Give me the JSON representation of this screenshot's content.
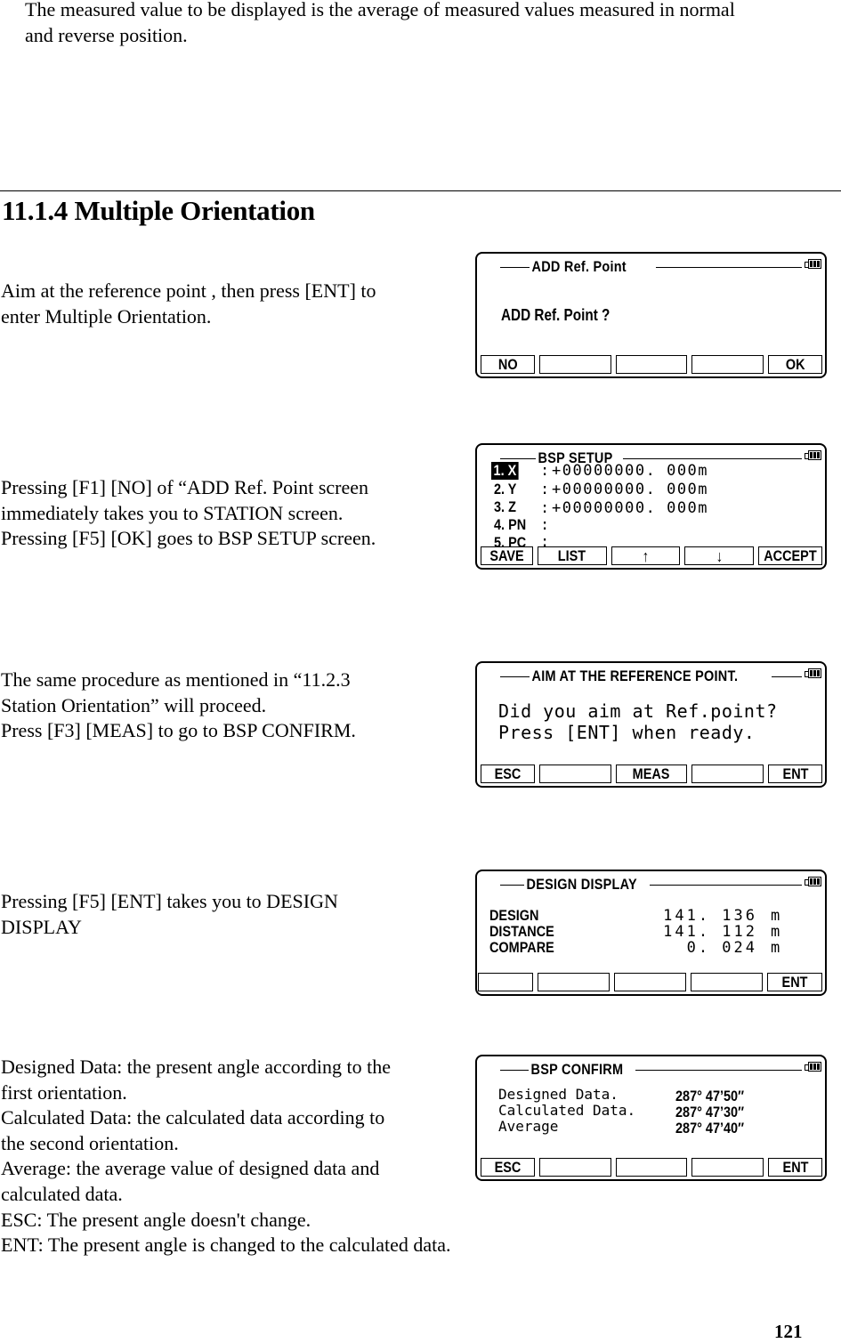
{
  "intro": {
    "text": "The measured value to be displayed is the average of measured values measured in normal\nand reverse position."
  },
  "section": {
    "heading": "11.1.4 Multiple Orientation"
  },
  "steps": [
    {
      "description": "Aim at the reference point , then press [ENT] to\nenter Multiple Orientation.",
      "screen": {
        "title": "ADD Ref. Point",
        "message": "ADD Ref. Point ?",
        "softkeys": [
          "NO",
          "",
          "",
          "",
          "OK"
        ]
      }
    },
    {
      "description": "Pressing [F1] [NO]  of “ADD Ref. Point screen\nimmediately takes you to STATION screen.\nPressing [F5] [OK] goes to BSP SETUP screen.",
      "screen": {
        "title": "BSP SETUP",
        "fields": [
          {
            "label": "1. X",
            "value": "+00000000. 000m",
            "selected": true
          },
          {
            "label": "2. Y",
            "value": "+00000000. 000m",
            "selected": false
          },
          {
            "label": "3. Z",
            "value": "+00000000. 000m",
            "selected": false
          },
          {
            "label": "4. PN",
            "value": "",
            "selected": false
          },
          {
            "label": "5. PC",
            "value": "",
            "selected": false
          }
        ],
        "softkeys": [
          "SAVE",
          "LIST",
          "↑",
          "↓",
          "ACCEPT"
        ],
        "softkey_icons": [
          "",
          "",
          "arrow-up-icon",
          "arrow-down-icon",
          ""
        ]
      }
    },
    {
      "description": "The same procedure as mentioned in “11.2.3\nStation Orientation” will proceed.\nPress [F3] [MEAS] to go to BSP CONFIRM.",
      "screen": {
        "title": "AIM AT THE REFERENCE POINT.",
        "lines": [
          "Did you aim at Ref.point?",
          "Press [ENT] when ready."
        ],
        "softkeys": [
          "ESC",
          "",
          "MEAS",
          "",
          "ENT"
        ]
      }
    },
    {
      "description": "Pressing [F5] [ENT] takes you to DESIGN\nDISPLAY",
      "screen": {
        "title": "DESIGN DISPLAY",
        "rows": [
          {
            "label": "DESIGN",
            "value": "141. 136",
            "unit": "m"
          },
          {
            "label": "DISTANCE",
            "value": "141. 112",
            "unit": "m"
          },
          {
            "label": "COMPARE",
            "value": "0. 024",
            "unit": "m"
          }
        ],
        "softkeys": [
          "",
          "",
          "",
          "",
          "ENT"
        ]
      }
    },
    {
      "description": "Designed Data: the present angle according to the\nfirst orientation.\nCalculated Data: the calculated data according to\nthe second orientation.\nAverage: the average value of designed data and\ncalculated data.\nESC: The present angle doesn't change.\nENT: The present angle is changed to the calculated data.",
      "screen": {
        "title": "BSP CONFIRM",
        "rows": [
          {
            "label": "Designed Data.",
            "value": "287° 47’50″"
          },
          {
            "label": "Calculated Data.",
            "value": "287° 47’30″"
          },
          {
            "label": "Average",
            "value": "287° 47’40″"
          }
        ],
        "softkeys": [
          "ESC",
          "",
          "",
          "",
          "ENT"
        ]
      }
    }
  ],
  "page": {
    "number": "121"
  }
}
